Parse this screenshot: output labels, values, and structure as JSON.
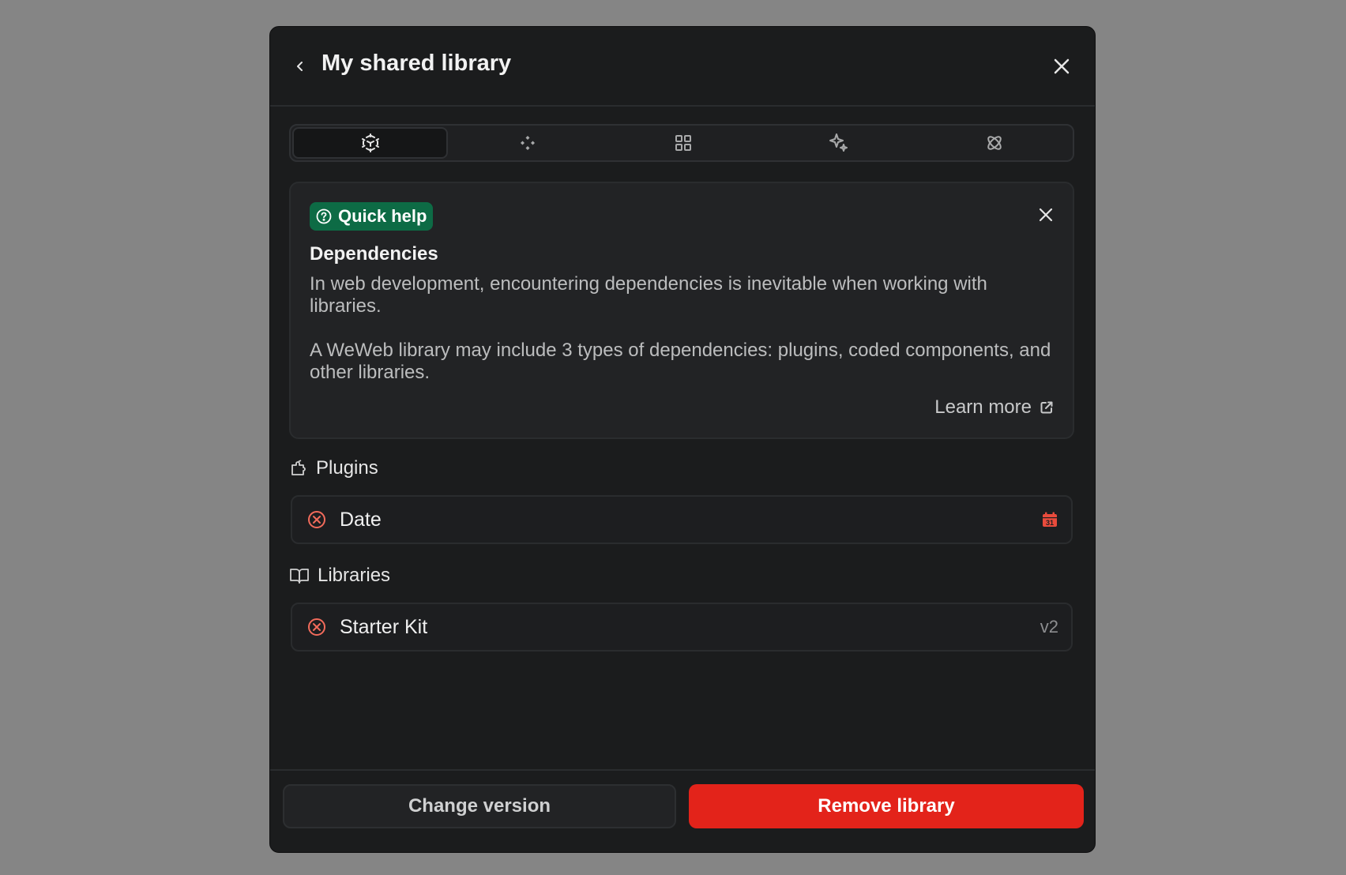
{
  "header": {
    "title": "My shared library"
  },
  "tabs": [
    {
      "icon": "cube-icon",
      "active": true
    },
    {
      "icon": "diamonds-icon",
      "active": false
    },
    {
      "icon": "grid-icon",
      "active": false
    },
    {
      "icon": "sparkles-icon",
      "active": false
    },
    {
      "icon": "atom-icon",
      "active": false
    }
  ],
  "help": {
    "badge": "Quick help",
    "heading": "Dependencies",
    "paragraph1": "In web development, encountering dependencies is inevitable when working with libraries.",
    "paragraph2": "A WeWeb library may include 3 types of dependencies: plugins, coded components, and other libraries.",
    "learn_more": "Learn more"
  },
  "plugins": {
    "label": "Plugins",
    "items": [
      {
        "name": "Date",
        "icon": "calendar-icon",
        "icon_text": "31"
      }
    ]
  },
  "libraries": {
    "label": "Libraries",
    "items": [
      {
        "name": "Starter Kit",
        "version": "v2"
      }
    ]
  },
  "footer": {
    "change_label": "Change version",
    "remove_label": "Remove library"
  },
  "colors": {
    "danger": "#e3231a",
    "error_icon": "#f26b5b",
    "help_badge": "#0d6b45",
    "panel": "#1b1c1d"
  }
}
